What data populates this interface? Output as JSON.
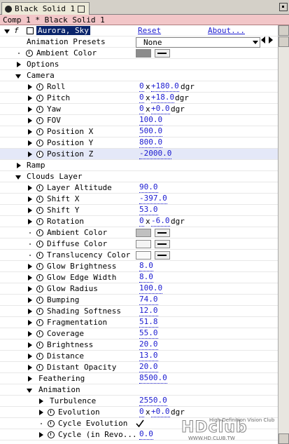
{
  "tab": {
    "title": "Black Solid 1"
  },
  "comp_bar": {
    "text": "Comp 1 * Black Solid 1"
  },
  "effect": {
    "fx_label": "f",
    "name": "Aurora, Sky",
    "reset": "Reset",
    "about": "About...",
    "presets_label": "Animation Presets",
    "presets_value": "None"
  },
  "rows": {
    "ambient_top": "Ambient Color",
    "options": "Options",
    "camera": "Camera",
    "roll": "Roll",
    "roll_rev": "0",
    "roll_deg": "+180.0",
    "roll_unit": "dgr",
    "pitch": "Pitch",
    "pitch_rev": "0",
    "pitch_deg": "+18.0",
    "pitch_unit": "dgr",
    "yaw": "Yaw",
    "yaw_rev": "0",
    "yaw_deg": "+0.0",
    "yaw_unit": "dgr",
    "fov": "FOV",
    "fov_val": "100.0",
    "posx": "Position X",
    "posx_val": "500.0",
    "posy": "Position Y",
    "posy_val": "800.0",
    "posz": "Position Z",
    "posz_val": "-2000.0",
    "ramp": "Ramp",
    "clouds": "Clouds Layer",
    "alt": "Layer Altitude",
    "alt_val": "90.0",
    "shx": "Shift X",
    "shx_val": "-397.0",
    "shy": "Shift Y",
    "shy_val": "53.0",
    "rot": "Rotation",
    "rot_rev": "0",
    "rot_deg": "-6.0",
    "rot_unit": "dgr",
    "amb": "Ambient Color",
    "diff": "Diffuse Color",
    "trans": "Translucency Color",
    "gb": "Glow Brightness",
    "gb_val": "8.0",
    "gew": "Glow Edge Width",
    "gew_val": "8.0",
    "gr": "Glow Radius",
    "gr_val": "100.0",
    "bump": "Bumping",
    "bump_val": "74.0",
    "ss": "Shading Softness",
    "ss_val": "12.0",
    "frag": "Fragmentation",
    "frag_val": "51.8",
    "cov": "Coverage",
    "cov_val": "55.0",
    "bri": "Brightness",
    "bri_val": "20.0",
    "dist": "Distance",
    "dist_val": "13.0",
    "dop": "Distant Opacity",
    "dop_val": "20.0",
    "feath": "Feathering",
    "feath_val": "8500.0",
    "anim": "Animation",
    "turb": "Turbulence",
    "turb_val": "2550.0",
    "evo": "Evolution",
    "evo_rev": "0",
    "evo_deg": "+0.0",
    "evo_unit": "dgr",
    "cevo": "Cycle Evolution",
    "cyc": "Cycle (in Revo...",
    "cyc_val": "0.0"
  },
  "times_sign": "x",
  "colors": {
    "ambient_top": "#8c8c8c",
    "amb": "#c0c0c0",
    "diff": "#f4f4f4",
    "trans": "#fafafa",
    "value_blue": "#1b1bd0",
    "comp_bar": "#f2c6c8",
    "selection": "#0a246a"
  },
  "watermark": {
    "logo": "HDclub",
    "sub": "High Definition Vision Club",
    "url": "WWW.HD.CLUB.TW"
  }
}
